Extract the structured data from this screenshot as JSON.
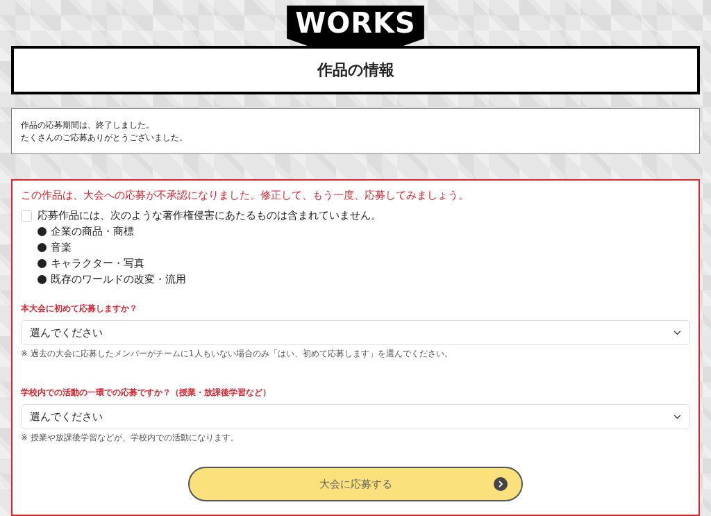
{
  "logo": "WORKS",
  "page_title": "作品の情報",
  "notice": [
    "作品の応募期間は、終了しました。",
    "たくさんのご応募ありがとうございました。"
  ],
  "error_message": "この作品は、大会への応募が不承認になりました。修正して、もう一度、応募してみましょう。",
  "agreement": {
    "label": "応募作品には、次のような著作権侵害にあたるものは含まれていません。",
    "checked": false,
    "items": [
      "企業の商品・商標",
      "音楽",
      "キャラクター・写真",
      "既存のワールドの改変・流用"
    ]
  },
  "questions": [
    {
      "label": "本大会に初めて応募しますか？",
      "value": "選んでください",
      "note": "※ 過去の大会に応募したメンバーがチームに1人もいない場合のみ「はい、初めて応募します」を選んでください。"
    },
    {
      "label": "学校内での活動の一環での応募ですか？（授業・放課後学習など）",
      "value": "選んでください",
      "note": "※ 授業や放課後学習などが、学校内での活動になります。"
    }
  ],
  "submit": {
    "label": "大会に応募する",
    "disabled": true
  }
}
